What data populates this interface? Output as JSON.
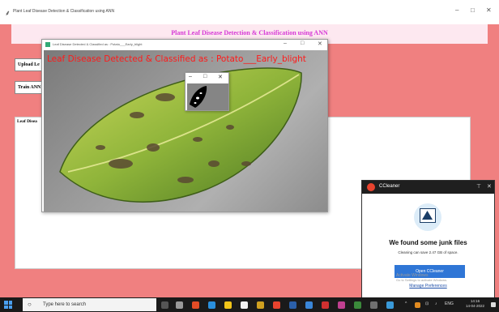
{
  "app": {
    "window_title": "Plant Leaf Disease Detection & Classification using ANN",
    "header_title": "Plant Leaf Disease Detection & Classification using ANN",
    "buttons": {
      "upload": "Upload Le",
      "train": "Train ANN"
    },
    "result_label": "Leaf Disea",
    "controls": {
      "minimize": "–",
      "maximize": "□",
      "close": "✕"
    }
  },
  "image_window": {
    "title": "Leaf Disease Detected & Classified as : Potato___Early_blight",
    "overlay_text": "Leaf Disease Detected & Classified as : Potato___Early_blight",
    "controls": {
      "minimize": "–",
      "maximize": "□",
      "close": "✕"
    }
  },
  "mask_window": {
    "controls": {
      "minimize": "–",
      "maximize": "□",
      "close": "✕"
    }
  },
  "ccleaner": {
    "app_name": "CCleaner",
    "heading": "We found some junk files",
    "subtext": "Cleaning can save 2.47 GB of space.",
    "button_label": "Open CCleaner",
    "watermark_line1": "Activate Windows",
    "watermark_line2": "Go to Settings to activate Windows.",
    "link": "Manage Preferences",
    "pin": "⊤",
    "close": "✕"
  },
  "taskbar": {
    "search_placeholder": "Type here to search",
    "tray_text": "ENG",
    "time": "14:16",
    "date": "14-04-2022"
  },
  "colors": {
    "app_background": "#f08080",
    "header_band": "#fde8f0",
    "header_title": "#d63ad6",
    "overlay_text": "#ff1a1a",
    "ccleaner_button": "#2f76d6",
    "taskbar": "#1a1a1a"
  }
}
